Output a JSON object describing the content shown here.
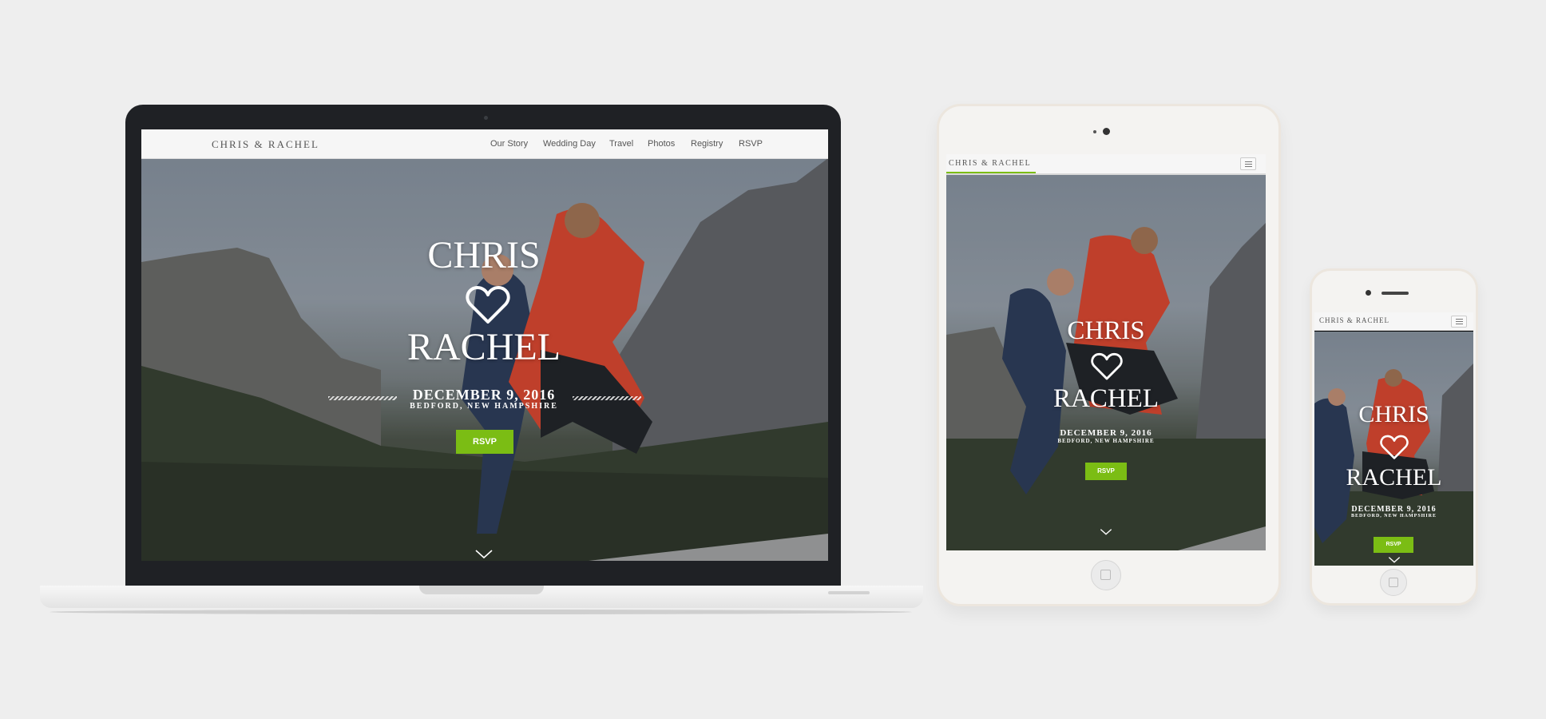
{
  "site": {
    "brand": "CHRIS & RACHEL",
    "nav": [
      "Our Story",
      "Wedding Day",
      "Travel",
      "Photos",
      "Registry",
      "RSVP"
    ],
    "hero": {
      "name1": "CHRIS",
      "name2": "RACHEL",
      "date": "DECEMBER 9, 2016",
      "location": "BEDFORD, NEW HAMPSHIRE",
      "rsvp_label": "RSVP"
    }
  },
  "colors": {
    "accent": "#7bbd14",
    "background": "#eeeeee",
    "laptop_bezel": "#1f2125",
    "device_white": "#f4f3f1"
  },
  "icons": [
    "heart-icon",
    "chevron-down-icon",
    "hamburger-menu-icon"
  ]
}
